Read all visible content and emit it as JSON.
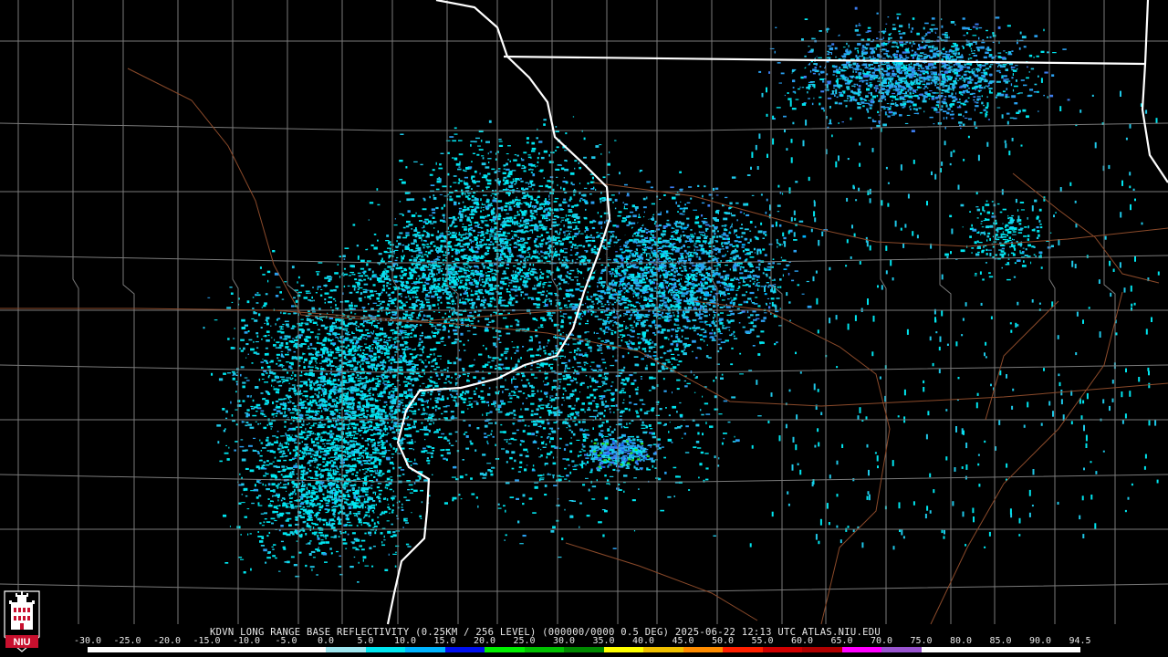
{
  "product_title": "KDVN LONG RANGE BASE REFLECTIVITY (0.25KM / 256 LEVEL) (000000/0000 0.5 DEG) 2025-06-22 12:13 UTC  ATLAS.NIU.EDU",
  "logo": {
    "name": "niu-logo",
    "text": "NIU",
    "colors": {
      "red": "#c8102e",
      "white": "#ffffff"
    }
  },
  "scale": {
    "unit_values": [
      "-30.0",
      "-25.0",
      "-20.0",
      "-15.0",
      "-10.0",
      "-5.0",
      "0.0",
      "5.0",
      "10.0",
      "15.0",
      "20.0",
      "25.0",
      "30.0",
      "35.0",
      "40.0",
      "45.0",
      "50.0",
      "55.0",
      "60.0",
      "65.0",
      "70.0",
      "75.0",
      "80.0",
      "85.0",
      "90.0",
      "94.5"
    ],
    "colors": [
      "#ffffff",
      "#ffffff",
      "#ffffff",
      "#ffffff",
      "#ffffff",
      "#ffffff",
      "#9fe7f0",
      "#00e6f0",
      "#00b4ff",
      "#0010f0",
      "#00f000",
      "#00c000",
      "#008800",
      "#ffff00",
      "#f0c000",
      "#ff8c00",
      "#ff2000",
      "#d00000",
      "#b00000",
      "#ff00ff",
      "#9a55d0",
      "#ffffff",
      "#ffffff",
      "#ffffff",
      "#ffffff"
    ]
  },
  "map": {
    "background": "#000000",
    "county_line_color": "#7a7a7a",
    "state_line_color": "#ffffff",
    "road_color": "#8b4a2a",
    "echo_colors": [
      "#00e6f0",
      "#1fc8e8",
      "#2aa0f0",
      "#3c7cf0",
      "#00b4ff"
    ],
    "spot_colors": [
      "#2ee01e",
      "#1e60f0"
    ]
  }
}
